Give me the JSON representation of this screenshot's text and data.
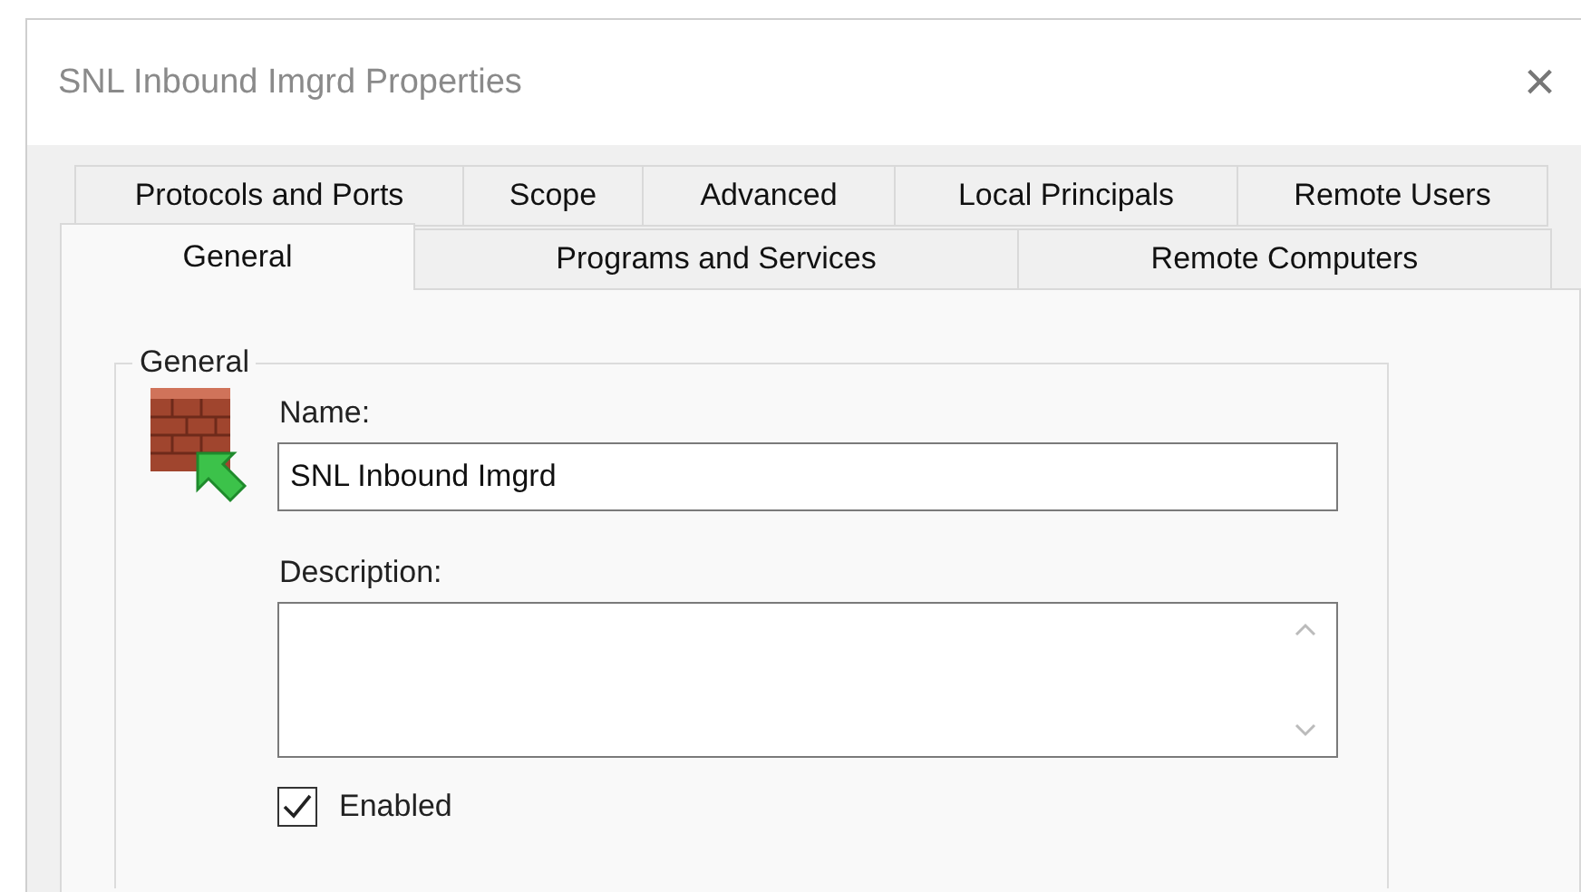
{
  "window": {
    "title": "SNL Inbound Imgrd Properties",
    "close": "×"
  },
  "tab_rows": [
    [
      {
        "label": "Protocols and Ports",
        "selected": false
      },
      {
        "label": "Scope",
        "selected": false
      },
      {
        "label": "Advanced",
        "selected": false
      },
      {
        "label": "Local Principals",
        "selected": false
      },
      {
        "label": "Remote Users",
        "selected": false
      }
    ],
    [
      {
        "label": "General",
        "selected": true
      },
      {
        "label": "Programs and Services",
        "selected": false
      },
      {
        "label": "Remote Computers",
        "selected": false
      }
    ]
  ],
  "group": {
    "title": "General",
    "name_label": "Name:",
    "name_value": "SNL Inbound Imgrd",
    "description_label": "Description:",
    "enabled": {
      "label": "Enabled",
      "checked": true
    }
  }
}
